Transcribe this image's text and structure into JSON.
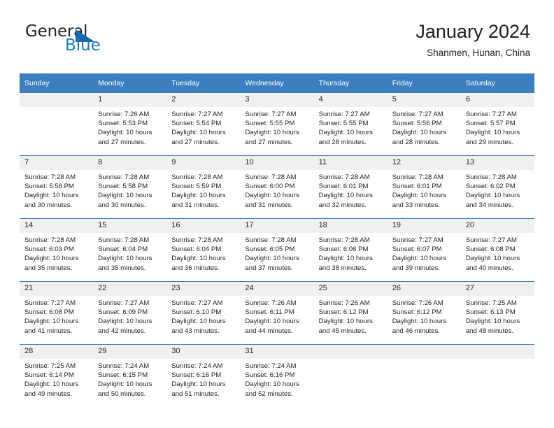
{
  "brand": {
    "name_dark": "General",
    "name_blue": "Blue",
    "accent_color": "#1569b0",
    "blue_text_color": "#1b7fc4"
  },
  "header": {
    "title": "January 2024",
    "subtitle": "Shanmen, Hunan, China"
  },
  "calendar": {
    "header_bg": "#3b7fbf",
    "daynum_bg": "#f0f0f0",
    "weekday_headers": [
      "Sunday",
      "Monday",
      "Tuesday",
      "Wednesday",
      "Thursday",
      "Friday",
      "Saturday"
    ],
    "weeks": [
      [
        {
          "day": "",
          "sunrise": "",
          "sunset": "",
          "daylight": ""
        },
        {
          "day": "1",
          "sunrise": "Sunrise: 7:26 AM",
          "sunset": "Sunset: 5:53 PM",
          "daylight": "Daylight: 10 hours and 27 minutes."
        },
        {
          "day": "2",
          "sunrise": "Sunrise: 7:27 AM",
          "sunset": "Sunset: 5:54 PM",
          "daylight": "Daylight: 10 hours and 27 minutes."
        },
        {
          "day": "3",
          "sunrise": "Sunrise: 7:27 AM",
          "sunset": "Sunset: 5:55 PM",
          "daylight": "Daylight: 10 hours and 27 minutes."
        },
        {
          "day": "4",
          "sunrise": "Sunrise: 7:27 AM",
          "sunset": "Sunset: 5:55 PM",
          "daylight": "Daylight: 10 hours and 28 minutes."
        },
        {
          "day": "5",
          "sunrise": "Sunrise: 7:27 AM",
          "sunset": "Sunset: 5:56 PM",
          "daylight": "Daylight: 10 hours and 28 minutes."
        },
        {
          "day": "6",
          "sunrise": "Sunrise: 7:27 AM",
          "sunset": "Sunset: 5:57 PM",
          "daylight": "Daylight: 10 hours and 29 minutes."
        }
      ],
      [
        {
          "day": "7",
          "sunrise": "Sunrise: 7:28 AM",
          "sunset": "Sunset: 5:58 PM",
          "daylight": "Daylight: 10 hours and 30 minutes."
        },
        {
          "day": "8",
          "sunrise": "Sunrise: 7:28 AM",
          "sunset": "Sunset: 5:58 PM",
          "daylight": "Daylight: 10 hours and 30 minutes."
        },
        {
          "day": "9",
          "sunrise": "Sunrise: 7:28 AM",
          "sunset": "Sunset: 5:59 PM",
          "daylight": "Daylight: 10 hours and 31 minutes."
        },
        {
          "day": "10",
          "sunrise": "Sunrise: 7:28 AM",
          "sunset": "Sunset: 6:00 PM",
          "daylight": "Daylight: 10 hours and 31 minutes."
        },
        {
          "day": "11",
          "sunrise": "Sunrise: 7:28 AM",
          "sunset": "Sunset: 6:01 PM",
          "daylight": "Daylight: 10 hours and 32 minutes."
        },
        {
          "day": "12",
          "sunrise": "Sunrise: 7:28 AM",
          "sunset": "Sunset: 6:01 PM",
          "daylight": "Daylight: 10 hours and 33 minutes."
        },
        {
          "day": "13",
          "sunrise": "Sunrise: 7:28 AM",
          "sunset": "Sunset: 6:02 PM",
          "daylight": "Daylight: 10 hours and 34 minutes."
        }
      ],
      [
        {
          "day": "14",
          "sunrise": "Sunrise: 7:28 AM",
          "sunset": "Sunset: 6:03 PM",
          "daylight": "Daylight: 10 hours and 35 minutes."
        },
        {
          "day": "15",
          "sunrise": "Sunrise: 7:28 AM",
          "sunset": "Sunset: 6:04 PM",
          "daylight": "Daylight: 10 hours and 35 minutes."
        },
        {
          "day": "16",
          "sunrise": "Sunrise: 7:28 AM",
          "sunset": "Sunset: 6:04 PM",
          "daylight": "Daylight: 10 hours and 36 minutes."
        },
        {
          "day": "17",
          "sunrise": "Sunrise: 7:28 AM",
          "sunset": "Sunset: 6:05 PM",
          "daylight": "Daylight: 10 hours and 37 minutes."
        },
        {
          "day": "18",
          "sunrise": "Sunrise: 7:28 AM",
          "sunset": "Sunset: 6:06 PM",
          "daylight": "Daylight: 10 hours and 38 minutes."
        },
        {
          "day": "19",
          "sunrise": "Sunrise: 7:27 AM",
          "sunset": "Sunset: 6:07 PM",
          "daylight": "Daylight: 10 hours and 39 minutes."
        },
        {
          "day": "20",
          "sunrise": "Sunrise: 7:27 AM",
          "sunset": "Sunset: 6:08 PM",
          "daylight": "Daylight: 10 hours and 40 minutes."
        }
      ],
      [
        {
          "day": "21",
          "sunrise": "Sunrise: 7:27 AM",
          "sunset": "Sunset: 6:08 PM",
          "daylight": "Daylight: 10 hours and 41 minutes."
        },
        {
          "day": "22",
          "sunrise": "Sunrise: 7:27 AM",
          "sunset": "Sunset: 6:09 PM",
          "daylight": "Daylight: 10 hours and 42 minutes."
        },
        {
          "day": "23",
          "sunrise": "Sunrise: 7:27 AM",
          "sunset": "Sunset: 6:10 PM",
          "daylight": "Daylight: 10 hours and 43 minutes."
        },
        {
          "day": "24",
          "sunrise": "Sunrise: 7:26 AM",
          "sunset": "Sunset: 6:11 PM",
          "daylight": "Daylight: 10 hours and 44 minutes."
        },
        {
          "day": "25",
          "sunrise": "Sunrise: 7:26 AM",
          "sunset": "Sunset: 6:12 PM",
          "daylight": "Daylight: 10 hours and 45 minutes."
        },
        {
          "day": "26",
          "sunrise": "Sunrise: 7:26 AM",
          "sunset": "Sunset: 6:12 PM",
          "daylight": "Daylight: 10 hours and 46 minutes."
        },
        {
          "day": "27",
          "sunrise": "Sunrise: 7:25 AM",
          "sunset": "Sunset: 6:13 PM",
          "daylight": "Daylight: 10 hours and 48 minutes."
        }
      ],
      [
        {
          "day": "28",
          "sunrise": "Sunrise: 7:25 AM",
          "sunset": "Sunset: 6:14 PM",
          "daylight": "Daylight: 10 hours and 49 minutes."
        },
        {
          "day": "29",
          "sunrise": "Sunrise: 7:24 AM",
          "sunset": "Sunset: 6:15 PM",
          "daylight": "Daylight: 10 hours and 50 minutes."
        },
        {
          "day": "30",
          "sunrise": "Sunrise: 7:24 AM",
          "sunset": "Sunset: 6:16 PM",
          "daylight": "Daylight: 10 hours and 51 minutes."
        },
        {
          "day": "31",
          "sunrise": "Sunrise: 7:24 AM",
          "sunset": "Sunset: 6:16 PM",
          "daylight": "Daylight: 10 hours and 52 minutes."
        },
        {
          "day": "",
          "sunrise": "",
          "sunset": "",
          "daylight": ""
        },
        {
          "day": "",
          "sunrise": "",
          "sunset": "",
          "daylight": ""
        },
        {
          "day": "",
          "sunrise": "",
          "sunset": "",
          "daylight": ""
        }
      ]
    ]
  }
}
